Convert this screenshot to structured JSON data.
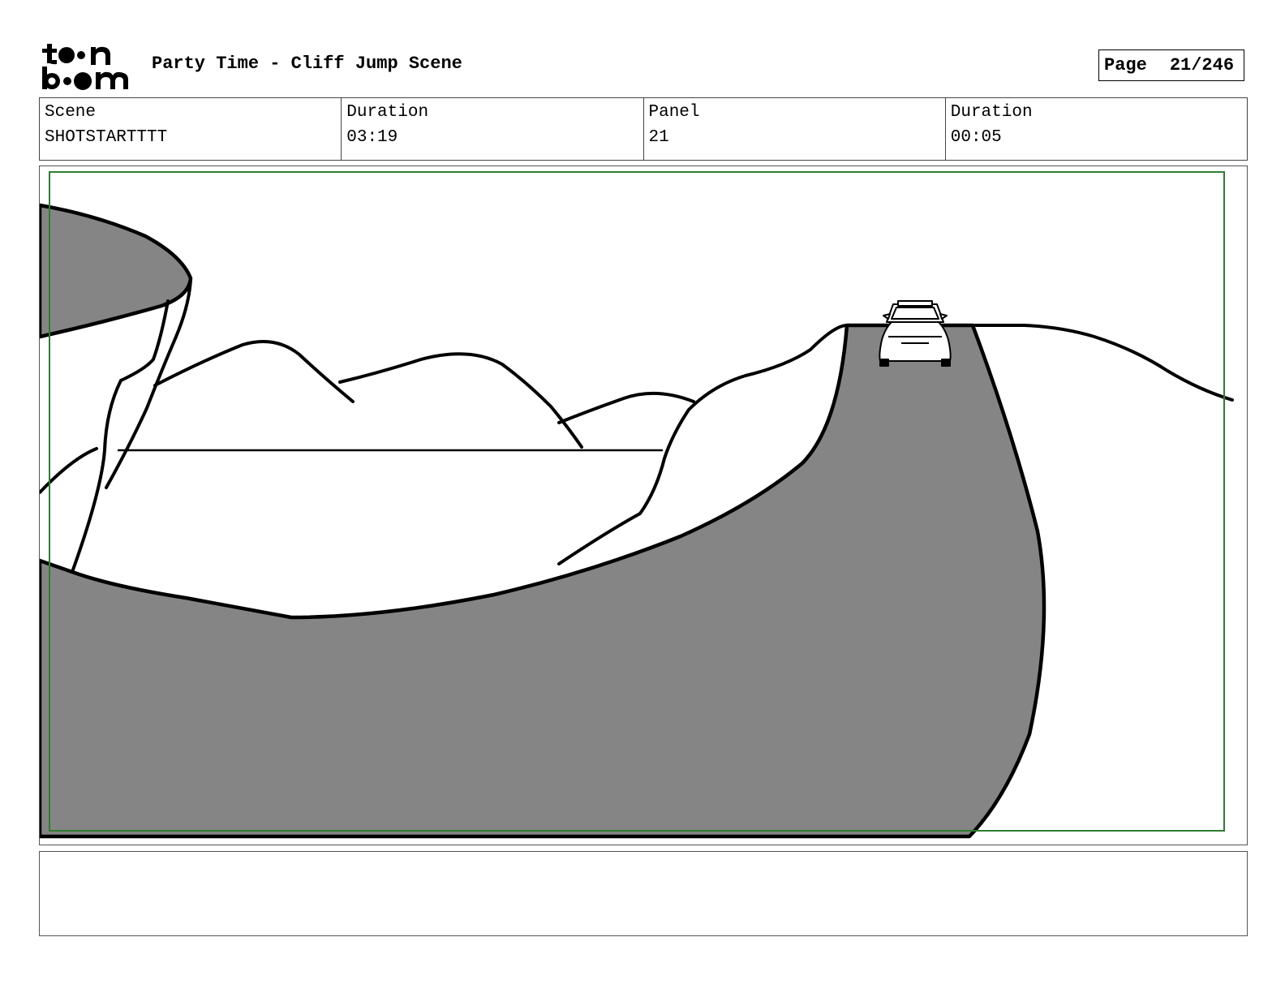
{
  "header": {
    "logo_text": "toonboom",
    "title": "Party Time - Cliff Jump Scene",
    "page_label": "Page",
    "page_value": "21/246"
  },
  "info": [
    {
      "label": "Scene",
      "value": "SHOTSTARTTTT"
    },
    {
      "label": "Duration",
      "value": "03:19"
    },
    {
      "label": "Panel",
      "value": "21"
    },
    {
      "label": "Duration",
      "value": "00:05"
    }
  ],
  "panel": {
    "safe_frame_color": "#2e7d32",
    "fill_color": "#858585",
    "line_color": "#000000"
  },
  "notes": {
    "text": ""
  }
}
